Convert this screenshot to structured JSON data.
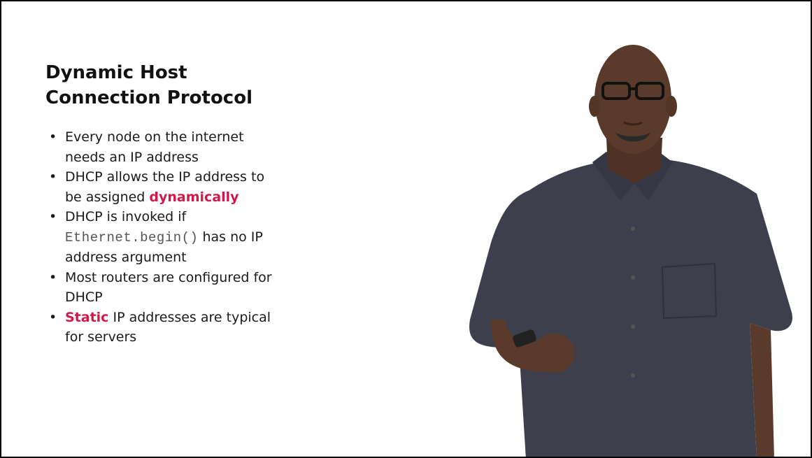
{
  "slide": {
    "title_line1": "Dynamic Host",
    "title_line2": "Connection Protocol",
    "bullets": {
      "b1": "Every node on the internet needs an IP address",
      "b2_pre": "DHCP allows the IP address to be assigned ",
      "b2_hl": "dynamically",
      "b3_pre": "DHCP is invoked if ",
      "b3_code": "Ethernet.begin()",
      "b3_post": " has no IP address argument",
      "b4": "Most routers are configured for DHCP",
      "b5_hl": "Static",
      "b5_post": " IP addresses are typical for servers"
    }
  },
  "colors": {
    "highlight": "#d1184a",
    "shirt": "#3d3f4c",
    "skin": "#5a3a2a",
    "background": "#ffffff"
  }
}
